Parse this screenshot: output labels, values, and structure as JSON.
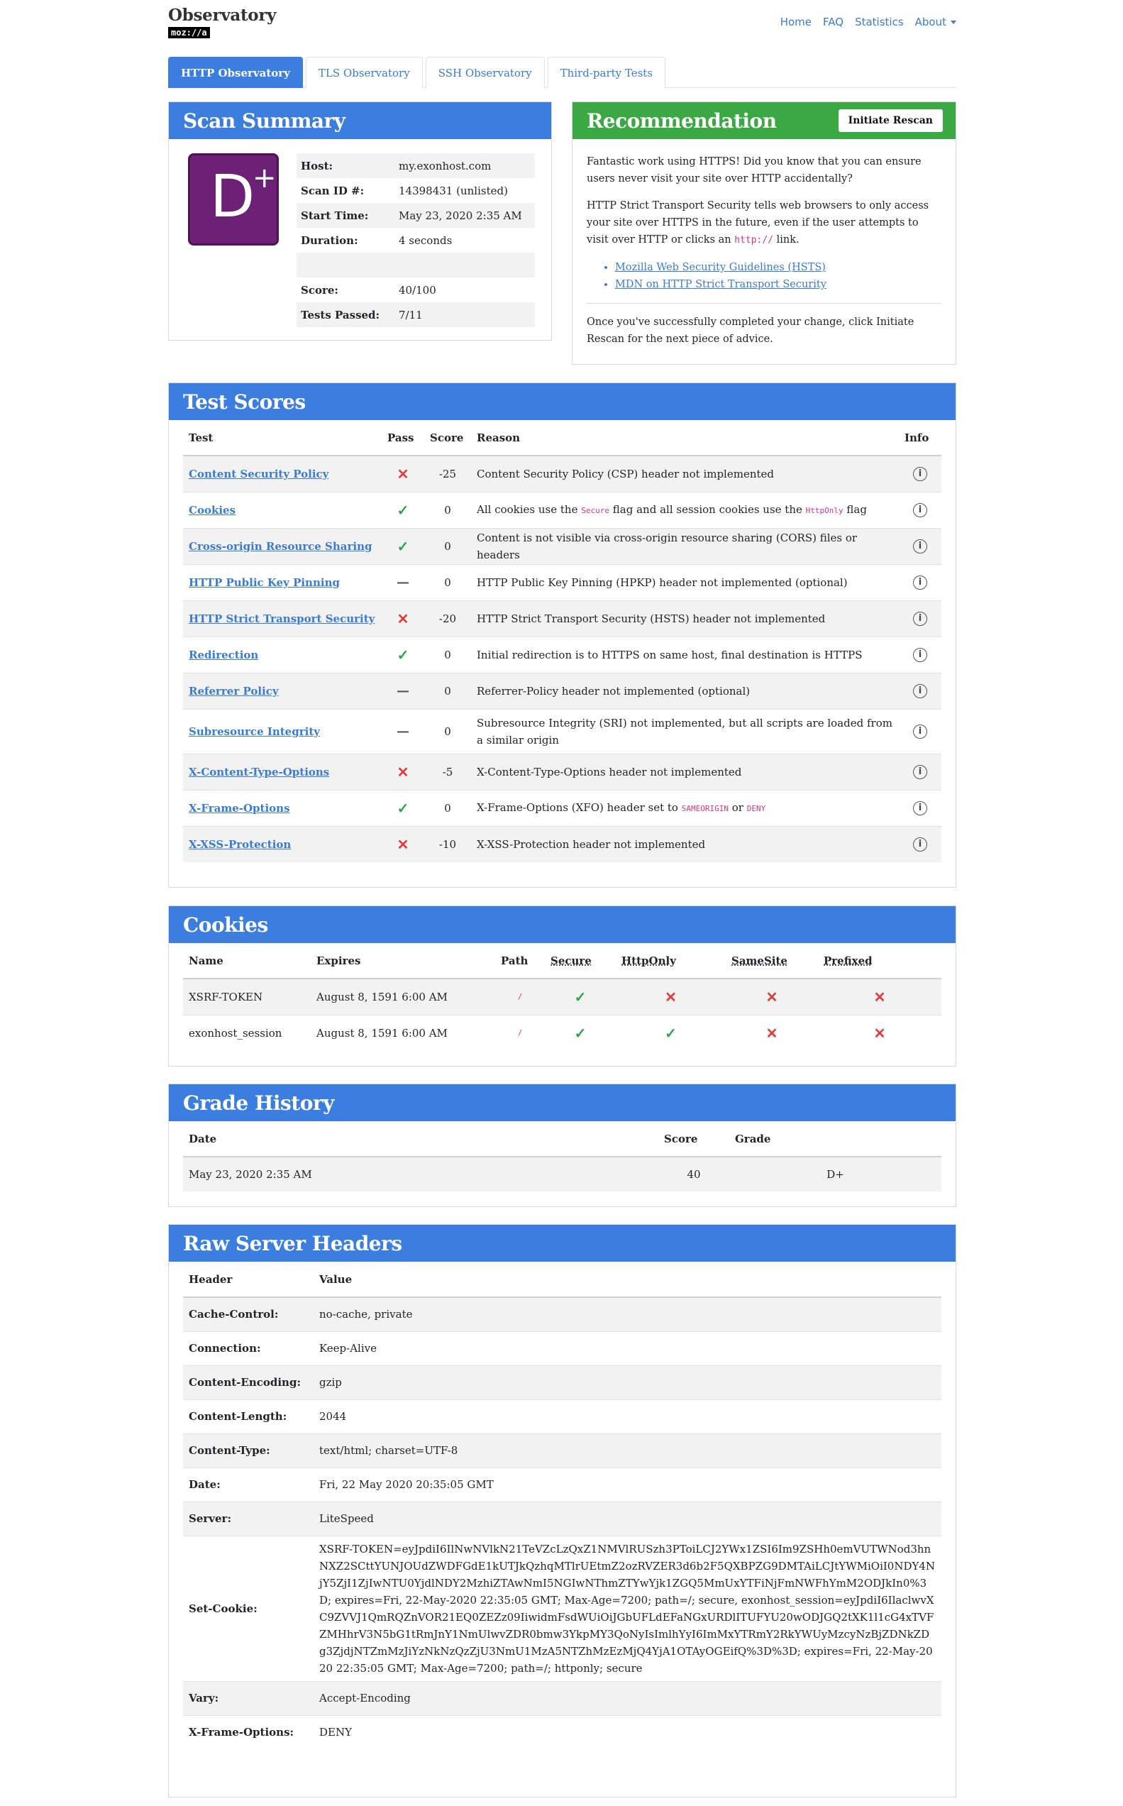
{
  "brand": {
    "title": "Observatory",
    "sub": "moz://a"
  },
  "nav": {
    "home": "Home",
    "faq": "FAQ",
    "statistics": "Statistics",
    "about": "About"
  },
  "tabs": [
    "HTTP Observatory",
    "TLS Observatory",
    "SSH Observatory",
    "Third-party Tests"
  ],
  "summary": {
    "title": "Scan Summary",
    "grade_letter": "D",
    "grade_mod": "+",
    "rows": [
      {
        "k": "Host:",
        "v": "my.exonhost.com"
      },
      {
        "k": "Scan ID #:",
        "v": "14398431 (unlisted)"
      },
      {
        "k": "Start Time:",
        "v": "May 23, 2020 2:35 AM"
      },
      {
        "k": "Duration:",
        "v": "4 seconds"
      },
      {
        "k": "",
        "v": ""
      },
      {
        "k": "Score:",
        "v": "40/100"
      },
      {
        "k": "Tests Passed:",
        "v": "7/11"
      }
    ]
  },
  "recommendation": {
    "title": "Recommendation",
    "button": "Initiate Rescan",
    "p1": "Fantastic work using HTTPS! Did you know that you can ensure users never visit your site over HTTP accidentally?",
    "p2a": "HTTP Strict Transport Security tells web browsers to only access your site over HTTPS in the future, even if the user attempts to visit over HTTP or clicks an",
    "p2code": "http://",
    "p2b": "link.",
    "links": [
      "Mozilla Web Security Guidelines (HSTS)",
      "MDN on HTTP Strict Transport Security"
    ],
    "p3": "Once you've successfully completed your change, click Initiate Rescan for the next piece of advice."
  },
  "tests": {
    "title": "Test Scores",
    "headers": {
      "test": "Test",
      "pass": "Pass",
      "score": "Score",
      "reason": "Reason",
      "info": "Info"
    },
    "rows": [
      {
        "test": "Content Security Policy",
        "pass": "fail",
        "score": "-25",
        "reason": "Content Security Policy (CSP) header not implemented"
      },
      {
        "test": "Cookies",
        "pass": "pass",
        "score": "0",
        "reason": "All cookies use the",
        "code1": "Secure",
        "mid": "flag and all session cookies use the",
        "code2": "HttpOnly",
        "end": "flag"
      },
      {
        "test": "Cross-origin Resource Sharing",
        "pass": "pass",
        "score": "0",
        "reason": "Content is not visible via cross-origin resource sharing (CORS) files or headers"
      },
      {
        "test": "HTTP Public Key Pinning",
        "pass": "neutral",
        "score": "0",
        "reason": "HTTP Public Key Pinning (HPKP) header not implemented (optional)"
      },
      {
        "test": "HTTP Strict Transport Security",
        "pass": "fail",
        "score": "-20",
        "reason": "HTTP Strict Transport Security (HSTS) header not implemented"
      },
      {
        "test": "Redirection",
        "pass": "pass",
        "score": "0",
        "reason": "Initial redirection is to HTTPS on same host, final destination is HTTPS"
      },
      {
        "test": "Referrer Policy",
        "pass": "neutral",
        "score": "0",
        "reason": "Referrer-Policy header not implemented (optional)"
      },
      {
        "test": "Subresource Integrity",
        "pass": "neutral",
        "score": "0",
        "reason": "Subresource Integrity (SRI) not implemented, but all scripts are loaded from a similar origin"
      },
      {
        "test": "X-Content-Type-Options",
        "pass": "fail",
        "score": "-5",
        "reason": "X-Content-Type-Options header not implemented"
      },
      {
        "test": "X-Frame-Options",
        "pass": "pass",
        "score": "0",
        "reason": "X-Frame-Options (XFO) header set to",
        "code1": "SAMEORIGIN",
        "mid": "or",
        "code2": "DENY",
        "end": ""
      },
      {
        "test": "X-XSS-Protection",
        "pass": "fail",
        "score": "-10",
        "reason": "X-XSS-Protection header not implemented"
      }
    ]
  },
  "cookies": {
    "title": "Cookies",
    "headers": {
      "name": "Name",
      "expires": "Expires",
      "path": "Path",
      "secure": "Secure",
      "httponly": "HttpOnly",
      "samesite": "SameSite",
      "prefixed": "Prefixed"
    },
    "rows": [
      {
        "name": "XSRF-TOKEN",
        "expires": "August 8, 1591 6:00 AM",
        "path": "/",
        "secure": "pass",
        "httponly": "fail",
        "samesite": "fail",
        "prefixed": "fail"
      },
      {
        "name": "exonhost_session",
        "expires": "August 8, 1591 6:00 AM",
        "path": "/",
        "secure": "pass",
        "httponly": "pass",
        "samesite": "fail",
        "prefixed": "fail"
      }
    ]
  },
  "history": {
    "title": "Grade History",
    "headers": {
      "date": "Date",
      "score": "Score",
      "grade": "Grade"
    },
    "rows": [
      {
        "date": "May 23, 2020 2:35 AM",
        "score": "40",
        "grade": "D+"
      }
    ]
  },
  "headers": {
    "title": "Raw Server Headers",
    "cols": {
      "header": "Header",
      "value": "Value"
    },
    "rows": [
      {
        "k": "Cache-Control:",
        "v": "no-cache, private"
      },
      {
        "k": "Connection:",
        "v": "Keep-Alive"
      },
      {
        "k": "Content-Encoding:",
        "v": "gzip"
      },
      {
        "k": "Content-Length:",
        "v": "2044"
      },
      {
        "k": "Content-Type:",
        "v": "text/html; charset=UTF-8"
      },
      {
        "k": "Date:",
        "v": "Fri, 22 May 2020 20:35:05 GMT"
      },
      {
        "k": "Server:",
        "v": "LiteSpeed"
      },
      {
        "k": "Set-Cookie:",
        "v": "XSRF-TOKEN=eyJpdiI6IlNwNVlkN21TeVZcLzQxZ1NMVlRUSzh3PToiLCJ2YWx1ZSI6Im9ZSHh0emVUTWNod3hnNXZ2SCttYUNJOUdZWDFGdE1kUTJkQzhqMTlrUEtmZ2ozRVZER3d6b2F5QXBPZG9DMTAiLCJtYWMiOiI0NDY4NjY5ZjI1ZjIwNTU0YjdlNDY2MzhiZTAwNmI5NGIwNThmZTYwYjk1ZGQ5MmUxYTFiNjFmNWFhYmM2ODJkIn0%3D; expires=Fri, 22-May-2020 22:35:05 GMT; Max-Age=7200; path=/; secure, exonhost_session=eyJpdiI6IlaclwvXC9ZVVJ1QmRQZnVOR21EQ0ZEZz09IiwidmFsdWUiOiJGbUFLdEFaNGxURDlITUFYU20wODJGQ2tXK1l1cG4xTVFZMHhrV3N5bG1tRmJnY1NmUlwvZDR0bmw3YkpMY3QoNyIsImlhYyI6ImMxYTRmY2RkYWUyMzcyNzBjZDNkZDg3ZjdjNTZmMzJiYzNkNzQzZjU3NmU1MzA5NTZhMzEzMjQ4YjA1OTAyOGEifQ%3D%3D; expires=Fri, 22-May-2020 22:35:05 GMT; Max-Age=7200; path=/; httponly; secure"
      },
      {
        "k": "Vary:",
        "v": "Accept-Encoding"
      },
      {
        "k": "X-Frame-Options:",
        "v": "DENY"
      }
    ]
  },
  "colors": {
    "accent": "#3b7ee0",
    "success": "#3aa843",
    "grade": "#6c2176",
    "fail": "#e03c3c",
    "pass": "#2ba44a"
  }
}
